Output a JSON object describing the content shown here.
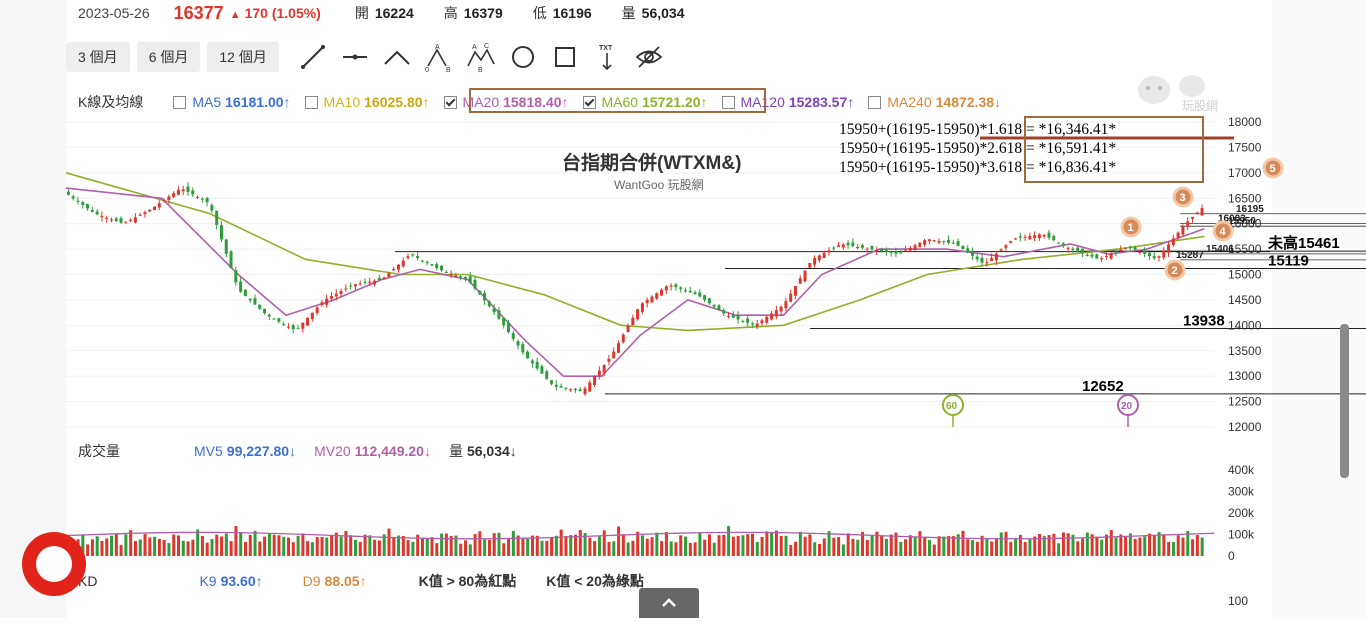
{
  "quote": {
    "date": "2023-05-26",
    "price": "16377",
    "change_arrow": "▲",
    "change": "170 (1.05%)",
    "open_label": "開",
    "open": "16224",
    "high_label": "高",
    "high": "16379",
    "low_label": "低",
    "low": "16196",
    "vol_label": "量",
    "volume": "56,034"
  },
  "toolbar": {
    "period_buttons": [
      "3 個月",
      "6 個月",
      "12 個月"
    ],
    "tools": [
      "trendline-icon",
      "horizontal-line-icon",
      "peak-line-icon",
      "abc-pattern-icon",
      "abcd-pattern-icon",
      "circle-icon",
      "rectangle-icon",
      "text-note-icon",
      "hide-icon"
    ],
    "text_tool_label": "TXT"
  },
  "ma_row": {
    "label": "K線及均線",
    "items": [
      {
        "name": "MA5",
        "value": "16181.00",
        "arrow": "↑",
        "checked": false,
        "color": "#3b6fd6"
      },
      {
        "name": "MA10",
        "value": "16025.80",
        "arrow": "↑",
        "checked": false,
        "color": "#d4b416"
      },
      {
        "name": "MA20",
        "value": "15818.40",
        "arrow": "↑",
        "checked": true,
        "color": "#b05fa8"
      },
      {
        "name": "MA60",
        "value": "15721.20",
        "arrow": "↑",
        "checked": true,
        "color": "#8fb02b"
      },
      {
        "name": "MA120",
        "value": "15283.57",
        "arrow": "↑",
        "checked": false,
        "color": "#7b45b8"
      },
      {
        "name": "MA240",
        "value": "14872.38",
        "arrow": "↓",
        "checked": false,
        "color": "#d6883c"
      }
    ]
  },
  "volume_row": {
    "label": "成交量",
    "mv5_name": "MV5",
    "mv5": "99,227.80",
    "mv5_arrow": "↓",
    "mv20_name": "MV20",
    "mv20": "112,449.20",
    "mv20_arrow": "↓",
    "vol_name": "量",
    "vol": "56,034",
    "vol_arrow": "↓"
  },
  "kd_row": {
    "label": "KD",
    "k_name": "K9",
    "k": "93.60",
    "k_arrow": "↑",
    "d_name": "D9",
    "d": "88.05",
    "d_arrow": "↑",
    "note1": "K值 > 80為紅點",
    "note2": "K值 < 20為綠點"
  },
  "annotations": {
    "fib_lines": [
      "15950+(16195-15950)*1.618 = *16,346.41*",
      "15950+(16195-15950)*2.618 = *16,591.41*",
      "15950+(16195-15950)*3.618 = *16,836.41*"
    ],
    "markers": [
      "1",
      "2",
      "3",
      "4",
      "5"
    ],
    "ma_markers": [
      "60",
      "20"
    ],
    "small_levels": [
      "16195",
      "16003",
      "15950",
      "15406",
      "15287"
    ],
    "big_levels": [
      "未高15461",
      "15119",
      "13938",
      "12652"
    ],
    "kd_bottom_tick": "100"
  },
  "chart_data": {
    "type": "candlestick",
    "title": "台指期合併(WTXM&)",
    "subtitle": "WantGoo 玩股網",
    "y_ticks": [
      18000,
      17500,
      17000,
      16500,
      16000,
      15500,
      15000,
      14500,
      14000,
      13500,
      13000,
      12500,
      12000
    ],
    "ylim": [
      12000,
      18000
    ],
    "volume_ticks": [
      "400k",
      "300k",
      "200k",
      "100k",
      "0"
    ],
    "horizontal_levels": [
      15461,
      15119,
      13938,
      12652
    ],
    "price_path": [
      [
        0,
        16600
      ],
      [
        6,
        16200
      ],
      [
        12,
        16000
      ],
      [
        18,
        16300
      ],
      [
        24,
        16700
      ],
      [
        30,
        16400
      ],
      [
        36,
        14700
      ],
      [
        42,
        14200
      ],
      [
        48,
        13900
      ],
      [
        54,
        14500
      ],
      [
        60,
        14800
      ],
      [
        66,
        14900
      ],
      [
        72,
        15400
      ],
      [
        78,
        15100
      ],
      [
        84,
        14900
      ],
      [
        90,
        14200
      ],
      [
        96,
        13400
      ],
      [
        102,
        12800
      ],
      [
        108,
        12700
      ],
      [
        114,
        13400
      ],
      [
        120,
        14400
      ],
      [
        126,
        14800
      ],
      [
        132,
        14600
      ],
      [
        138,
        14200
      ],
      [
        144,
        14000
      ],
      [
        150,
        14400
      ],
      [
        156,
        15300
      ],
      [
        162,
        15600
      ],
      [
        168,
        15500
      ],
      [
        174,
        15400
      ],
      [
        180,
        15700
      ],
      [
        186,
        15600
      ],
      [
        192,
        15200
      ],
      [
        198,
        15700
      ],
      [
        204,
        15800
      ],
      [
        210,
        15500
      ],
      [
        216,
        15300
      ],
      [
        222,
        15550
      ],
      [
        228,
        15300
      ],
      [
        234,
        16000
      ],
      [
        238,
        16350
      ]
    ],
    "ma20_path": [
      [
        0,
        16700
      ],
      [
        20,
        16500
      ],
      [
        36,
        15000
      ],
      [
        46,
        14200
      ],
      [
        56,
        14500
      ],
      [
        66,
        14900
      ],
      [
        74,
        15100
      ],
      [
        84,
        14900
      ],
      [
        96,
        13700
      ],
      [
        104,
        13000
      ],
      [
        112,
        13000
      ],
      [
        120,
        13800
      ],
      [
        130,
        14500
      ],
      [
        140,
        14200
      ],
      [
        150,
        14200
      ],
      [
        158,
        15000
      ],
      [
        170,
        15500
      ],
      [
        184,
        15500
      ],
      [
        196,
        15350
      ],
      [
        210,
        15600
      ],
      [
        218,
        15400
      ],
      [
        226,
        15500
      ],
      [
        238,
        15900
      ]
    ],
    "ma60_path": [
      [
        0,
        17000
      ],
      [
        30,
        16200
      ],
      [
        50,
        15300
      ],
      [
        70,
        15000
      ],
      [
        84,
        15000
      ],
      [
        100,
        14600
      ],
      [
        116,
        14000
      ],
      [
        130,
        13900
      ],
      [
        150,
        14000
      ],
      [
        166,
        14500
      ],
      [
        180,
        15000
      ],
      [
        200,
        15300
      ],
      [
        220,
        15500
      ],
      [
        238,
        15750
      ]
    ],
    "volume_k": [
      75,
      80,
      60,
      90,
      70,
      85,
      100,
      65,
      80,
      95,
      110,
      70,
      90,
      120,
      80,
      75,
      95,
      85,
      100,
      90,
      80,
      70,
      95,
      110,
      90,
      80,
      85,
      105,
      95,
      75,
      80,
      90,
      100,
      85,
      70,
      120,
      95,
      80,
      90,
      110,
      85,
      75,
      100,
      90,
      80,
      95,
      85,
      75,
      110,
      90,
      80,
      70,
      100,
      95,
      85,
      80,
      90,
      110,
      120,
      95,
      85,
      80,
      100,
      90,
      75,
      85,
      95,
      110,
      100,
      90,
      80,
      70,
      85,
      95,
      100,
      90,
      80,
      75,
      95,
      105
    ]
  }
}
